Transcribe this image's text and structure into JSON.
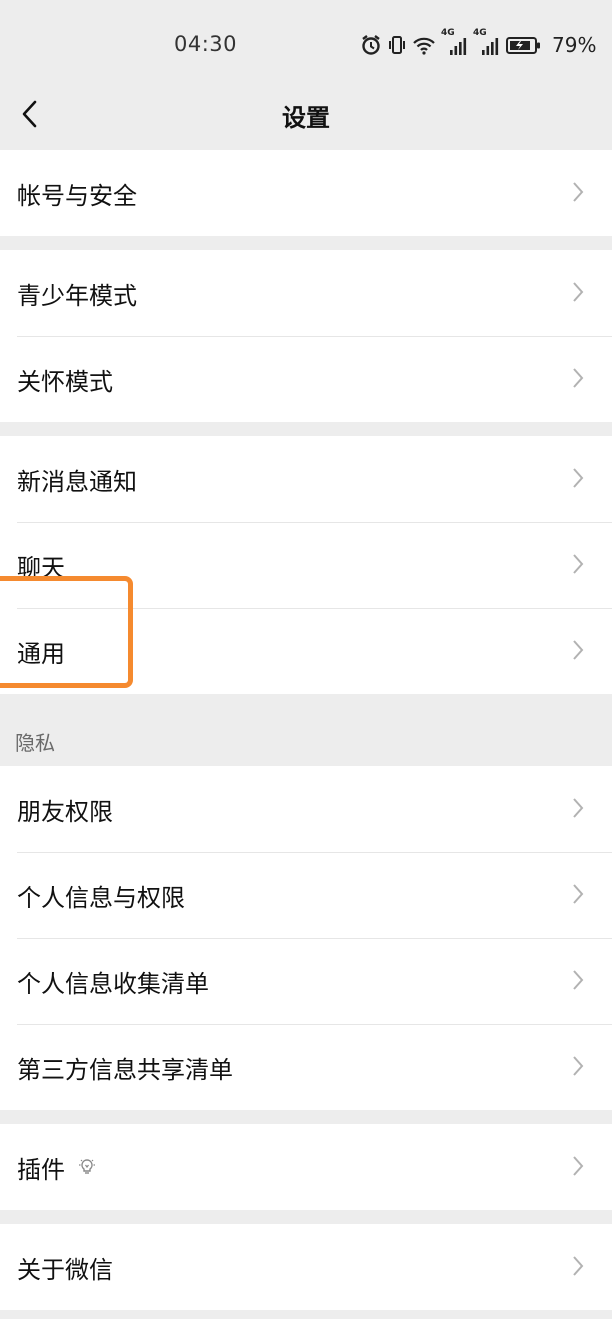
{
  "status_bar": {
    "time": "04:30",
    "battery_pct": "79%",
    "net_label_1": "4G",
    "net_label_2": "4G",
    "icons": [
      "alarm-icon",
      "vibrate-icon",
      "wifi-icon",
      "signal-icon",
      "signal-icon",
      "battery-charging-icon"
    ]
  },
  "nav": {
    "title": "设置",
    "back_icon": "chevron-left-icon"
  },
  "groups": [
    {
      "items": [
        {
          "label": "帐号与安全"
        }
      ]
    },
    {
      "items": [
        {
          "label": "青少年模式"
        },
        {
          "label": "关怀模式"
        }
      ]
    },
    {
      "items": [
        {
          "label": "新消息通知"
        },
        {
          "label": "聊天"
        },
        {
          "label": "通用"
        }
      ]
    },
    {
      "section_label": "隐私",
      "items": [
        {
          "label": "朋友权限"
        },
        {
          "label": "个人信息与权限"
        },
        {
          "label": "个人信息收集清单"
        },
        {
          "label": "第三方信息共享清单"
        }
      ]
    },
    {
      "items": [
        {
          "label": "插件",
          "icon": "lightbulb-icon"
        }
      ]
    },
    {
      "items": [
        {
          "label": "关于微信"
        }
      ]
    }
  ],
  "highlight": {
    "target": "通用",
    "color": "#f58a2f"
  },
  "colors": {
    "background": "#ededed",
    "row": "#ffffff",
    "chevron": "#b2b2b2"
  }
}
